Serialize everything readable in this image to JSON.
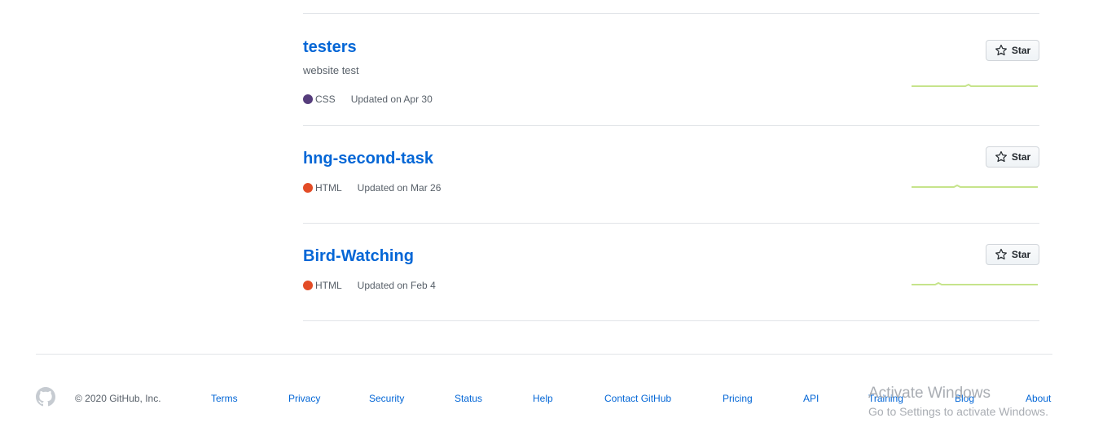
{
  "repositories": [
    {
      "name": "testers",
      "description": "website test",
      "language": "CSS",
      "language_color": "#563d7c",
      "updated": "Updated on Apr 30",
      "star_label": "Star"
    },
    {
      "name": "hng-second-task",
      "description": "",
      "language": "HTML",
      "language_color": "#e34c26",
      "updated": "Updated on Mar 26",
      "star_label": "Star"
    },
    {
      "name": "Bird-Watching",
      "description": "",
      "language": "HTML",
      "language_color": "#e34c26",
      "updated": "Updated on Feb 4",
      "star_label": "Star"
    }
  ],
  "footer": {
    "copyright": "© 2020 GitHub, Inc.",
    "links": [
      "Terms",
      "Privacy",
      "Security",
      "Status",
      "Help",
      "Contact GitHub",
      "Pricing",
      "API",
      "Training",
      "Blog",
      "About"
    ]
  },
  "watermark": {
    "title": "Activate Windows",
    "subtitle": "Go to Settings to activate Windows."
  },
  "colors": {
    "link": "#0366d6",
    "sparkline": "#c6e48b"
  }
}
